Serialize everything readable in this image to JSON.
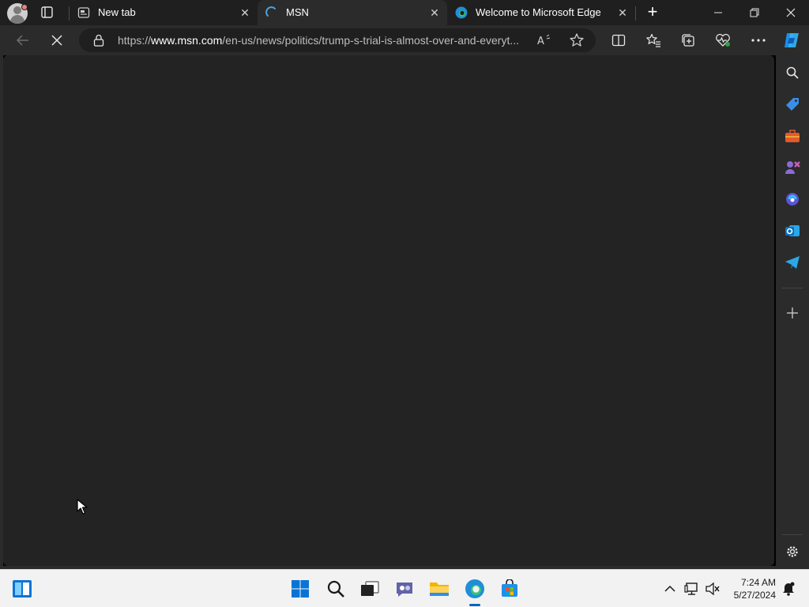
{
  "browser": {
    "tabs": [
      {
        "title": "New tab",
        "favicon": "new-tab-icon",
        "active": false
      },
      {
        "title": "MSN",
        "favicon": "loading-spinner-icon",
        "active": true
      },
      {
        "title": "Welcome to Microsoft Edge",
        "favicon": "edge-icon",
        "active": false
      }
    ],
    "address": {
      "url_prefix": "https://",
      "url_domain": "www.msn.com",
      "url_path": "/en-us/news/politics/trump-s-trial-is-almost-over-and-everyt..."
    },
    "accent_color": "#0078d4"
  },
  "sidebar": {
    "items": [
      "search-icon",
      "shopping-tag-icon",
      "tools-briefcase-icon",
      "games-icon",
      "copilot-icon",
      "outlook-icon",
      "telegram-icon",
      "add-icon",
      "settings-icon"
    ]
  },
  "taskbar": {
    "time": "7:24 AM",
    "date": "5/27/2024"
  }
}
